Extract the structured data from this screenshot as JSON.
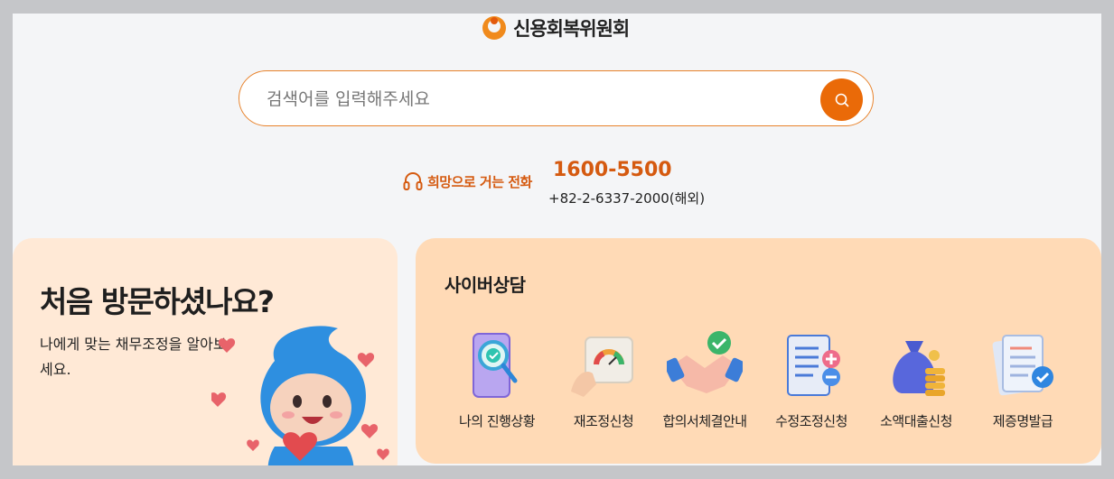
{
  "header": {
    "logo_text": "신용회복위원회"
  },
  "search": {
    "placeholder": "검색어를 입력해주세요"
  },
  "hotline": {
    "label": "희망으로 거는 전화",
    "number": "1600-5500",
    "overseas": "+82-2-6337-2000(해외)"
  },
  "welcome_card": {
    "title": "처음 방문하셨나요?",
    "description": "나에게 맞는 채무조정을 알아보세요."
  },
  "cyber_consult": {
    "title": "사이버상담",
    "services": [
      {
        "label": "나의 진행상황",
        "icon": "progress-check-icon"
      },
      {
        "label": "재조정신청",
        "icon": "gauge-icon"
      },
      {
        "label": "합의서체결안내",
        "icon": "handshake-icon"
      },
      {
        "label": "수정조정신청",
        "icon": "document-edit-icon"
      },
      {
        "label": "소액대출신청",
        "icon": "money-bag-icon"
      },
      {
        "label": "제증명발급",
        "icon": "certificate-icon"
      }
    ]
  },
  "colors": {
    "accent": "#ea6a08",
    "card_left_bg": "#ffe9d6",
    "card_right_bg": "#ffdab6"
  }
}
